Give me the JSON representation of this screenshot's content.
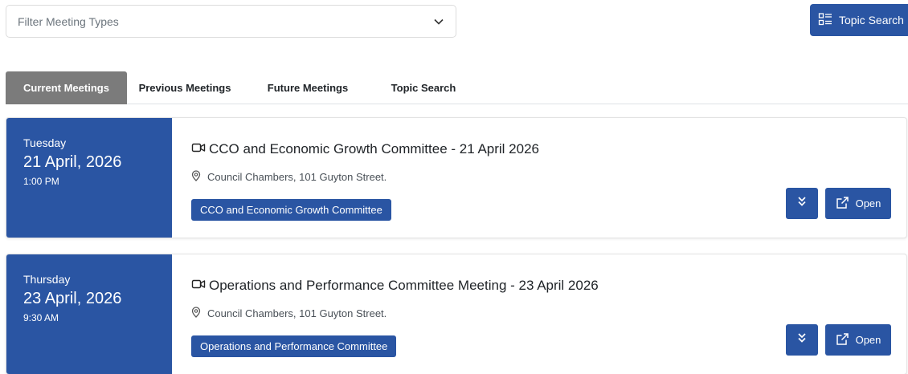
{
  "filter": {
    "placeholder": "Filter Meeting Types"
  },
  "topic_search_button": {
    "label": "Topic Search",
    "icon": "list-icon"
  },
  "tabs": [
    {
      "label": "Current Meetings",
      "active": true
    },
    {
      "label": "Previous Meetings",
      "active": false
    },
    {
      "label": "Future Meetings",
      "active": false
    },
    {
      "label": "Topic Search",
      "active": false
    }
  ],
  "meetings": [
    {
      "weekday": "Tuesday",
      "date": "21 April, 2026",
      "time": "1:00 PM",
      "title": "CCO and Economic Growth Committee - 21 April 2026",
      "location": "Council Chambers, 101 Guyton Street.",
      "committee": "CCO and Economic Growth Committee",
      "open_label": "Open"
    },
    {
      "weekday": "Thursday",
      "date": "23 April, 2026",
      "time": "9:30 AM",
      "title": "Operations and Performance Committee Meeting - 23 April 2026",
      "location": "Council Chambers, 101 Guyton Street.",
      "committee": "Operations and Performance Committee",
      "open_label": "Open"
    }
  ],
  "colors": {
    "primary": "#2a55a3",
    "tab_active": "#7b7b7b"
  }
}
